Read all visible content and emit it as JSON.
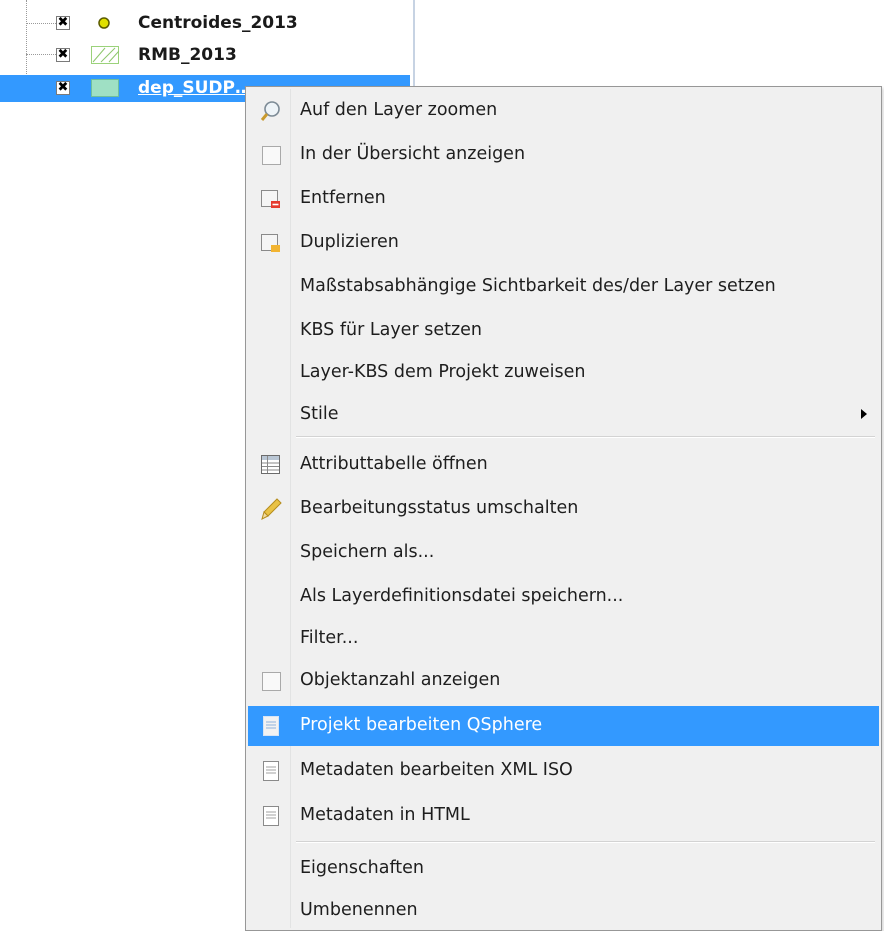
{
  "layers": [
    {
      "name": "Centroides_2013",
      "checked_glyph": "✖",
      "symbol": "point-symbol"
    },
    {
      "name": "RMB_2013",
      "checked_glyph": "✖",
      "symbol": "polygon-hatch-symbol"
    },
    {
      "name": "dep_SUDP…",
      "checked_glyph": "✖",
      "symbol": "polygon-fill-symbol",
      "selected": true
    }
  ],
  "menu": {
    "zoom_to_layer": "Auf den Layer zoomen",
    "show_in_overview": "In der Übersicht anzeigen",
    "remove": "Entfernen",
    "duplicate": "Duplizieren",
    "scale_visibility": "Maßstabsabhängige Sichtbarkeit des/der Layer setzen",
    "set_layer_crs": "KBS für Layer setzen",
    "set_project_crs": "Layer-KBS dem Projekt zuweisen",
    "styles": "Stile",
    "open_attribute_table": "Attributtabelle öffnen",
    "toggle_editing": "Bearbeitungsstatus umschalten",
    "save_as": "Speichern als...",
    "save_as_layer_definition": "Als Layerdefinitionsdatei speichern...",
    "filter": "Filter...",
    "show_feature_count": "Objektanzahl anzeigen",
    "edit_project_qsphere": "Projekt bearbeiten QSphere",
    "edit_metadata_xml": "Metadaten bearbeiten XML ISO",
    "metadata_html": "Metadaten in HTML",
    "properties": "Eigenschaften",
    "rename": "Umbenennen"
  },
  "colors": {
    "highlight": "#3399ff",
    "menu_bg": "#f0f0f0"
  }
}
